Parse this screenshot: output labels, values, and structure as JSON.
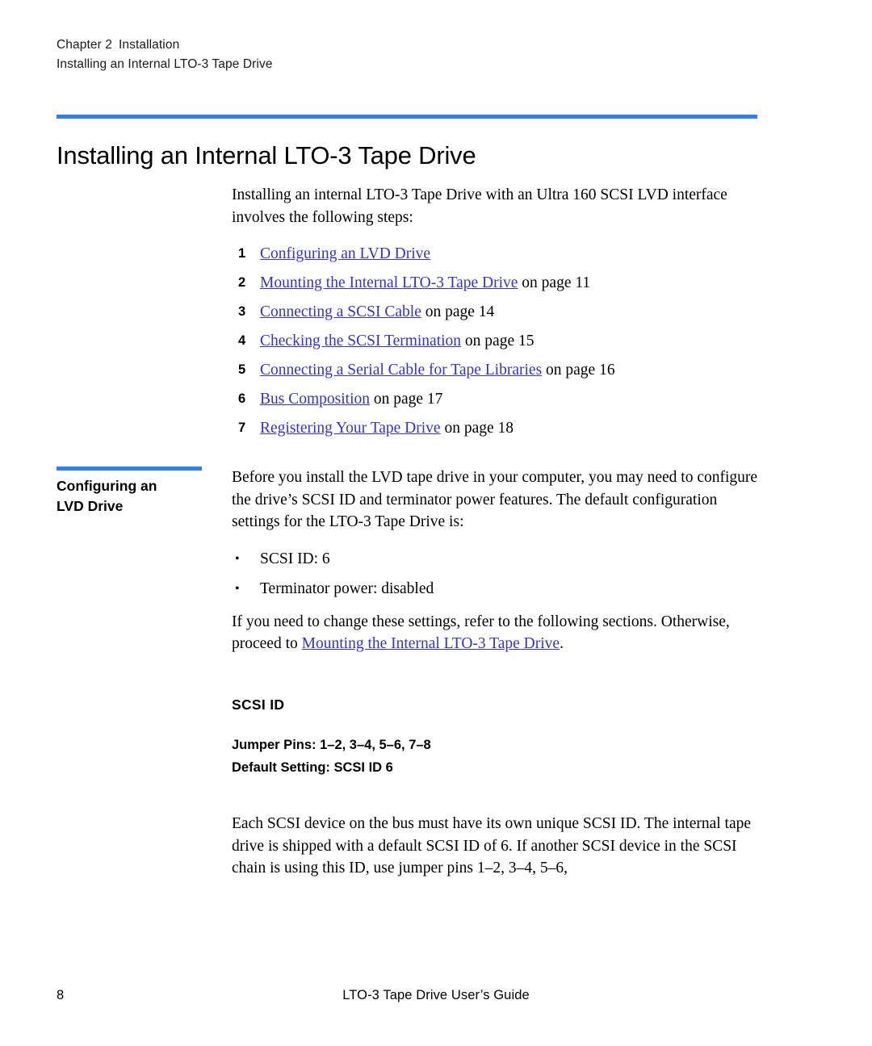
{
  "header": {
    "chapter": "Chapter 2",
    "chapter_title": "Installation",
    "section": "Installing an Internal LTO-3 Tape Drive"
  },
  "title": "Installing an Internal LTO-3 Tape Drive",
  "colors": {
    "rule_blue": "#2E7FF0",
    "link_blue": "#3333CC",
    "text": "#000000"
  },
  "intro": {
    "paragraph": "Installing an internal LTO-3 Tape Drive with an Ultra 160 SCSI LVD interface involves the following steps:",
    "steps": [
      {
        "num": "1",
        "link": "Configuring an LVD Drive",
        "tail": ""
      },
      {
        "num": "2",
        "link": "Mounting the Internal LTO-3 Tape Drive",
        "tail": " on page 11"
      },
      {
        "num": "3",
        "link": "Connecting a SCSI Cable",
        "tail": " on page 14"
      },
      {
        "num": "4",
        "link": "Checking the SCSI Termination",
        "tail": " on page 15"
      },
      {
        "num": "5",
        "link": "Connecting a Serial Cable for Tape Libraries",
        "tail": " on page 16"
      },
      {
        "num": "6",
        "link": "Bus Composition",
        "tail": " on page 17"
      },
      {
        "num": "7",
        "link": "Registering Your Tape Drive",
        "tail": " on page 18"
      }
    ]
  },
  "section_heading": {
    "line1": "Configuring an",
    "line2": "LVD Drive"
  },
  "section_body": {
    "intro_paragraph": "Before you install the LVD tape drive in your computer, you may need to configure the drive’s SCSI ID and terminator power features. The default configuration settings for the LTO-3 Tape Drive is:",
    "bullets": [
      "SCSI ID: 6",
      "Terminator power: disabled"
    ],
    "followup_prefix": "If you need to change these settings, refer to the following sections. Otherwise, proceed to ",
    "followup_link": "Mounting the Internal LTO-3 Tape Drive",
    "followup_suffix": ".",
    "scsi_id_heading": "SCSI ID",
    "jumper_pins": "Jumper Pins: 1–2, 3–4, 5–6, 7–8",
    "default_setting": "Default Setting: SCSI ID 6",
    "closing_paragraph": "Each SCSI device on the bus must have its own unique SCSI ID. The internal tape drive is shipped with a default SCSI ID of 6. If another SCSI device in the SCSI chain is using this ID, use jumper pins 1–2, 3–4, 5–6,"
  },
  "footer": {
    "page_number": "8",
    "document_title": "LTO-3 Tape Drive User’s Guide"
  }
}
